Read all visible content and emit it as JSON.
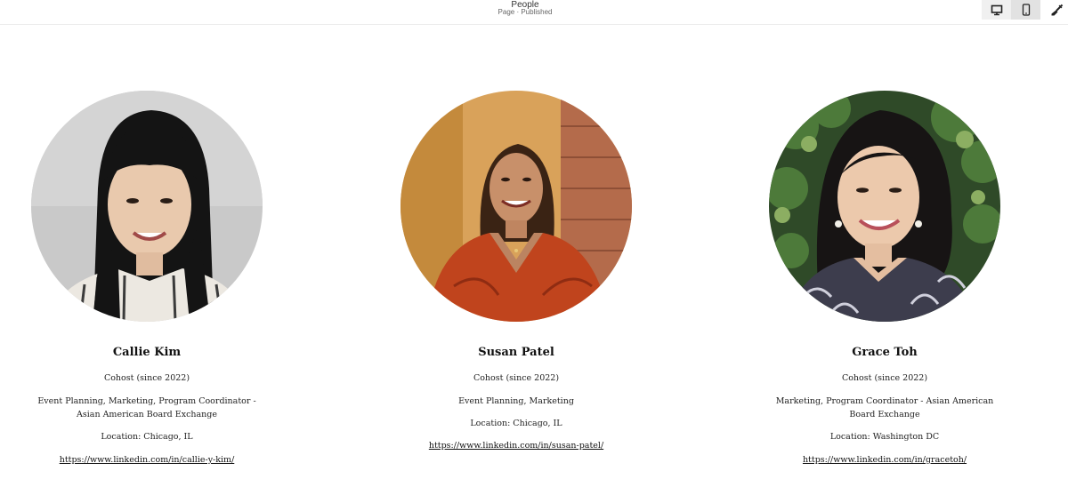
{
  "header": {
    "title": "People",
    "subtitle": "Page · Published",
    "desktop_icon": "desktop-icon",
    "mobile_icon": "mobile-icon",
    "brush_icon": "paintbrush-icon"
  },
  "people": [
    {
      "name": "Callie Kim",
      "role": "Cohost (since 2022)",
      "skills": "Event Planning, Marketing, Program Coordinator - Asian American Board Exchange",
      "location": "Location: Chicago, IL",
      "link": "https://www.linkedin.com/in/callie-y-kim/"
    },
    {
      "name": "Susan Patel",
      "role": "Cohost (since 2022)",
      "skills": "Event Planning, Marketing",
      "location": "Location: Chicago, IL",
      "link": "https://www.linkedin.com/in/susan-patel/"
    },
    {
      "name": "Grace Toh",
      "role": "Cohost (since 2022)",
      "skills": "Marketing, Program Coordinator - Asian American Board Exchange",
      "location": "Location: Washington DC",
      "link": "https://www.linkedin.com/in/gracetoh/"
    }
  ]
}
